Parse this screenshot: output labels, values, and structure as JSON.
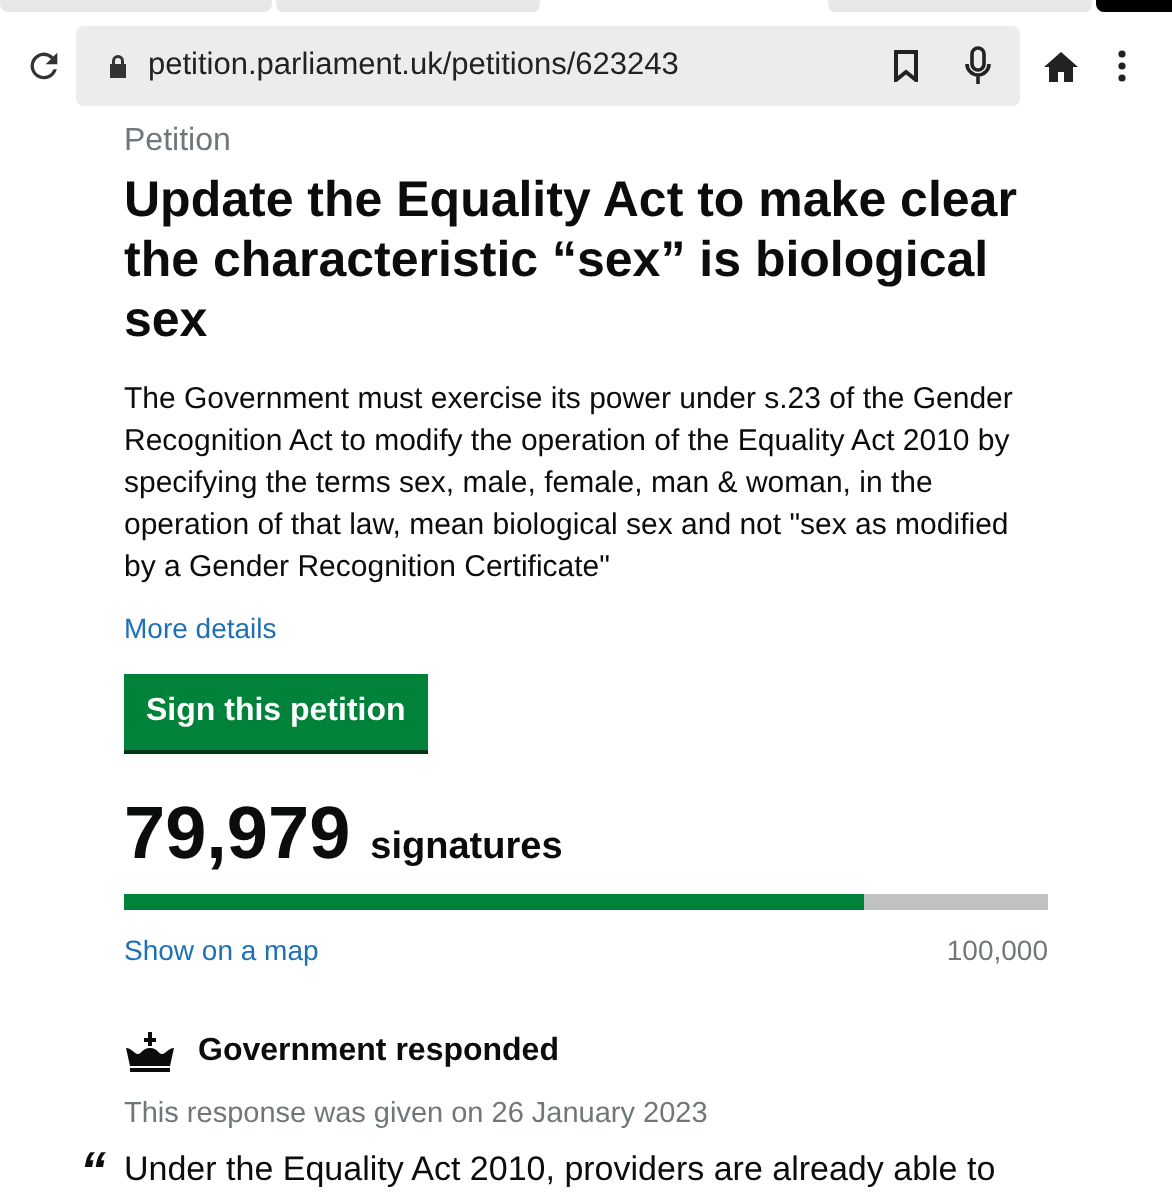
{
  "browser": {
    "url": "petition.parliament.uk/petitions/623243"
  },
  "page": {
    "kicker": "Petition",
    "title": "Update the Equality Act to make clear the characteristic “sex” is biological sex",
    "summary": "The Government must exercise its power under s.23 of the Gender Recognition Act to modify the operation of the Equality Act 2010 by specifying the terms sex, male, female, man & woman, in the operation of that law, mean biological sex and not \"sex as modified by a Gender Recognition Certificate\"",
    "more_link": "More details",
    "sign_button": "Sign this petition",
    "count": "79,979",
    "count_label": "signatures",
    "progress": {
      "level": 0.8
    },
    "map_link": "Show on a map",
    "target": "100,000",
    "response": {
      "heading": "Government responded",
      "date_line": "This response was given on 26 January 2023",
      "quote_mark": "“",
      "quote": "Under the Equality Act 2010, providers are already able to"
    }
  }
}
